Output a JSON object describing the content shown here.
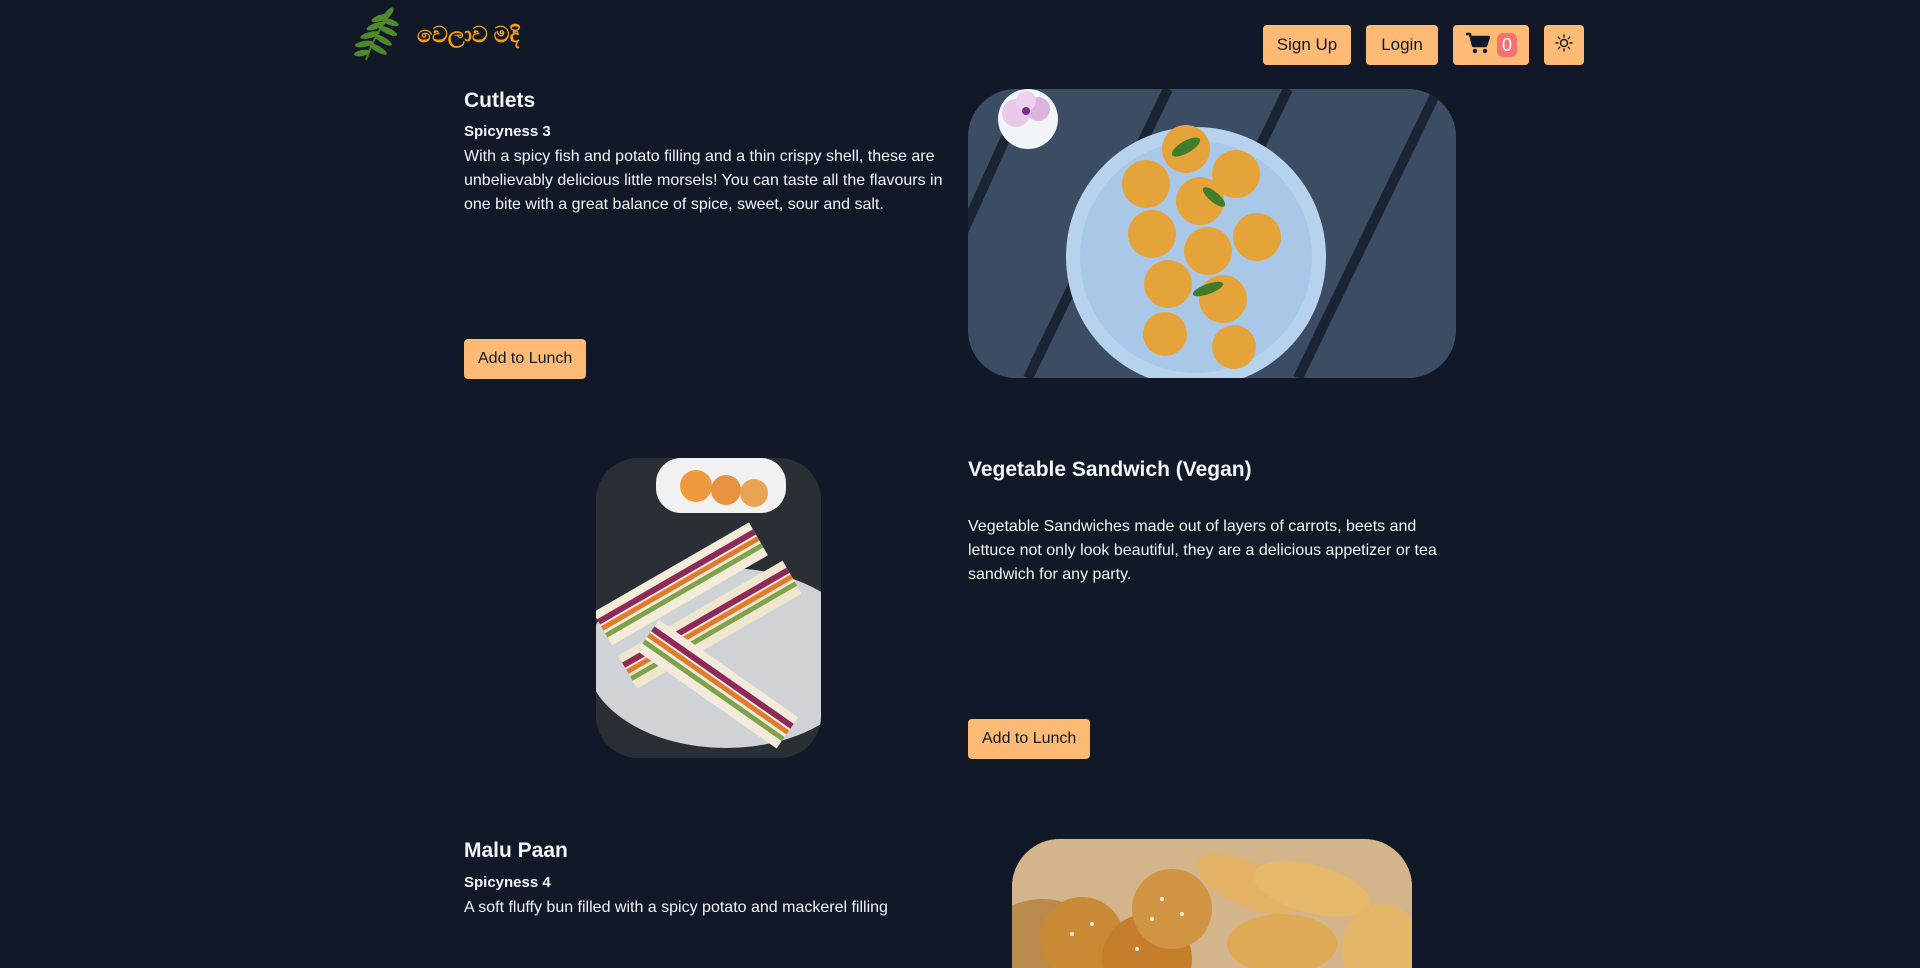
{
  "header": {
    "brand": "වෙලාව මදි",
    "signup_label": "Sign Up",
    "login_label": "Login",
    "cart_count": "0",
    "icons": {
      "logo": "leaf-logo-icon",
      "cart": "cart-icon",
      "theme": "sun-icon"
    }
  },
  "items": [
    {
      "title": "Cutlets",
      "spicyness": "Spicyness 3",
      "description": "With a spicy fish and potato filling and a thin crispy shell, these are unbelievably delicious little morsels! You can taste all the flavours in one bite with a great balance of spice, sweet, sour and salt.",
      "button": "Add to Lunch"
    },
    {
      "title": "Vegetable Sandwich (Vegan)",
      "spicyness": "",
      "description": "Vegetable Sandwiches made out of layers of carrots, beets and lettuce not only look beautiful, they are a delicious appetizer or tea sandwich for any party.",
      "button": "Add to Lunch"
    },
    {
      "title": "Malu Paan",
      "spicyness": "Spicyness 4",
      "description": "A soft fluffy bun filled with a spicy potato and mackerel filling"
    }
  ],
  "colors": {
    "background": "#111827",
    "accent": "#fdba74",
    "brand": "#f59e0b",
    "badge": "#f87171"
  }
}
